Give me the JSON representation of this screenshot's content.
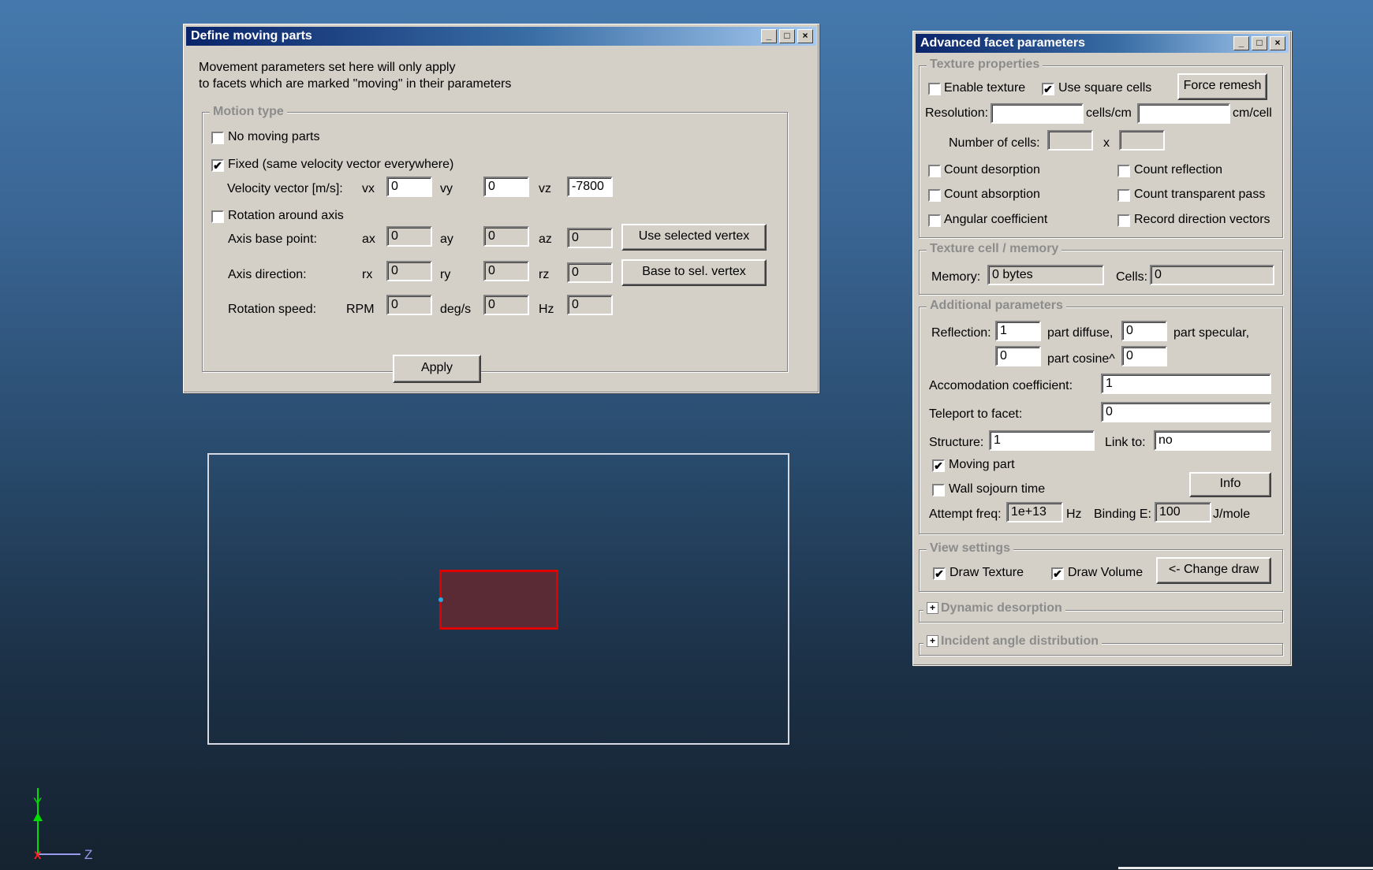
{
  "moving_parts": {
    "title": "Define moving parts",
    "info_line1": "Movement parameters set here will only apply",
    "info_line2": "to facets which are marked \"moving\" in their parameters",
    "group_title": "Motion type",
    "no_moving_label": "No moving parts",
    "no_moving_checked": false,
    "fixed_label": "Fixed (same velocity vector everywhere)",
    "fixed_checked": true,
    "velocity_label": "Velocity vector [m/s]:",
    "vx_label": "vx",
    "vx_value": "0",
    "vy_label": "vy",
    "vy_value": "0",
    "vz_label": "vz",
    "vz_value": "-7800",
    "rotation_label": "Rotation around axis",
    "rotation_checked": false,
    "base_label": "Axis base point:",
    "ax_label": "ax",
    "ax_value": "0",
    "ay_label": "ay",
    "ay_value": "0",
    "az_label": "az",
    "az_value": "0",
    "use_vertex_btn": "Use selected vertex",
    "dir_label": "Axis direction:",
    "rx_label": "rx",
    "rx_value": "0",
    "ry_label": "ry",
    "ry_value": "0",
    "rz_label": "rz",
    "rz_value": "0",
    "base_vertex_btn": "Base to sel. vertex",
    "speed_label": "Rotation speed:",
    "rpm_label": "RPM",
    "rpm_value": "0",
    "degs_label": "deg/s",
    "degs_value": "0",
    "hz_label": "Hz",
    "hz_value": "0",
    "apply_btn": "Apply"
  },
  "facet": {
    "title": "Advanced facet parameters",
    "texture_title": "Texture properties",
    "enable_texture": "Enable texture",
    "enable_texture_checked": false,
    "use_square": "Use square cells",
    "use_square_checked": true,
    "force_remesh": "Force remesh",
    "resolution": "Resolution:",
    "cells_cm": "cells/cm",
    "cm_cell": "cm/cell",
    "resolution_value": "",
    "cm_cell_value": "",
    "num_cells": "Number of cells:",
    "x": "x",
    "cells_x_value": "",
    "cells_y_value": "",
    "count_desorption": "Count desorption",
    "count_reflection": "Count reflection",
    "count_absorption": "Count absorption",
    "count_transparent": "Count transparent pass",
    "angular": "Angular coefficient",
    "record_dir": "Record direction vectors",
    "memory_title": "Texture cell / memory",
    "memory_label": "Memory:",
    "memory_value": "0 bytes",
    "cells_label": "Cells:",
    "cells_value": "0",
    "additional_title": "Additional parameters",
    "reflection": "Reflection:",
    "reflection_value": "1",
    "part_diffuse": "part diffuse,",
    "diffuse_value": "0",
    "part_specular": "part specular,",
    "specular_value": "0",
    "part_cosine": "part cosine^",
    "cosine_value": "0",
    "accom": "Accomodation coefficient:",
    "accom_value": "1",
    "teleport": "Teleport to facet:",
    "teleport_value": "0",
    "structure": "Structure:",
    "structure_value": "1",
    "link_to": "Link to:",
    "link_value": "no",
    "moving_part": "Moving part",
    "moving_part_checked": true,
    "wall_sojourn": "Wall sojourn time",
    "wall_sojourn_checked": false,
    "info_btn": "Info",
    "attempt": "Attempt freq:",
    "attempt_value": "1e+13",
    "hz": "Hz",
    "binding": "Binding E:",
    "binding_value": "100",
    "jmole": "J/mole",
    "view_title": "View settings",
    "draw_texture": "Draw Texture",
    "draw_texture_checked": true,
    "draw_volume": "Draw Volume",
    "draw_volume_checked": true,
    "change_draw": "<- Change draw",
    "dynamic_title": "Dynamic desorption",
    "incident_title": "Incident angle distribution"
  },
  "axes": {
    "y": "Y",
    "z": "Z",
    "x": "X"
  },
  "colors": {
    "facet_outline": "#e00000",
    "facet_fill": "#5a2a35",
    "axis_y": "#00dd00",
    "axis_z": "#9999ee",
    "axis_x": "#ff2020"
  }
}
